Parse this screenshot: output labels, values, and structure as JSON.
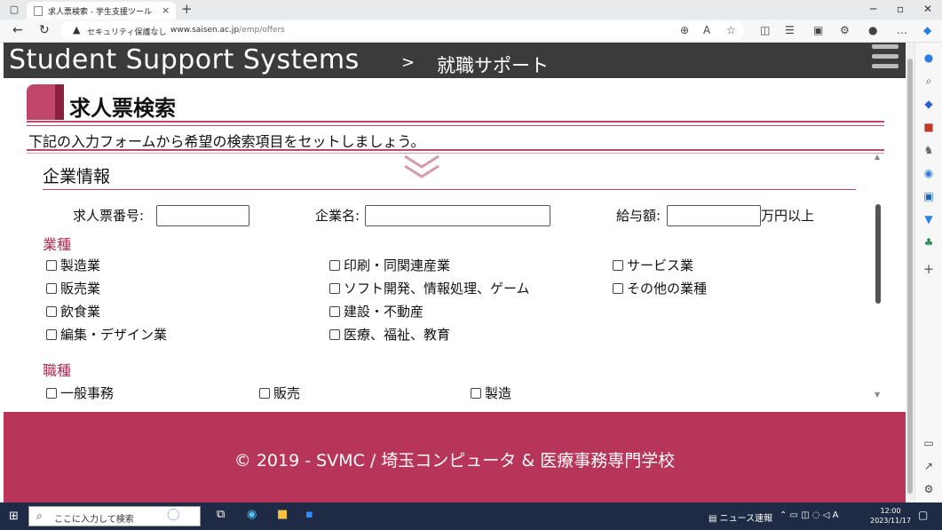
{
  "browser": {
    "tab_title": "求人票検索 - 学生支援ツール",
    "tab_close": "×",
    "new_tab": "+",
    "security_label": "セキュリティ保護なし",
    "url_host": "www.saisen.ac.jp",
    "url_path": "/emp/offers"
  },
  "header": {
    "brand": "Student Support Systems",
    "crumb_sep": ">",
    "crumb": "就職サポート"
  },
  "page": {
    "title": "求人票検索",
    "intro": "下記の入力フォームから希望の検索項目をセットしましょう。"
  },
  "form": {
    "section_title": "企業情報",
    "job_no_label": "求人票番号:",
    "job_no_value": "",
    "company_label": "企業名:",
    "company_value": "",
    "salary_label": "給与額:",
    "salary_value": "",
    "salary_suffix": "万円以上",
    "industry_title": "業種",
    "industries": [
      "製造業",
      "印刷・同関連産業",
      "サービス業",
      "販売業",
      "ソフト開発、情報処理、ゲーム",
      "その他の業種",
      "飲食業",
      "建設・不動産",
      "編集・デザイン業",
      "医療、福祉、教育"
    ],
    "occupation_title": "職種",
    "occupations": [
      "一般事務",
      "販売",
      "製造"
    ]
  },
  "footer": {
    "copyright": "© 2019 - SVMC / 埼玉コンピュータ & 医療事務専門学校"
  },
  "taskbar": {
    "search_placeholder": "ここに入力して検索",
    "news": "ニュース速報",
    "time": "12:00",
    "date": "2023/11/17"
  },
  "colors": {
    "accent": "#b73558",
    "header_bg": "#3b3b3b",
    "category_text": "#b02a52"
  }
}
